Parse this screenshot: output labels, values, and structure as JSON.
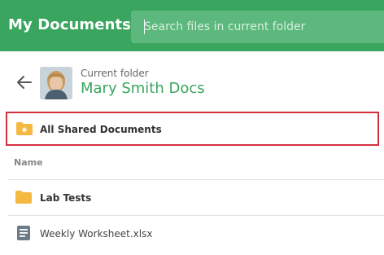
{
  "header": {
    "title": "My Documents",
    "search_placeholder": "Search files in current folder"
  },
  "folder": {
    "caption": "Current folder",
    "name": "Mary Smith Docs"
  },
  "shared": {
    "label": "All Shared Documents"
  },
  "list": {
    "column_name": "Name",
    "items": [
      {
        "label": "Lab Tests",
        "type": "folder",
        "icon": "folder-icon"
      },
      {
        "label": "Weekly Worksheet.xlsx",
        "type": "file",
        "icon": "document-icon"
      }
    ]
  },
  "colors": {
    "brand": "#3aa55f",
    "folder": "#f5b942",
    "highlight": "#d32f3f"
  }
}
